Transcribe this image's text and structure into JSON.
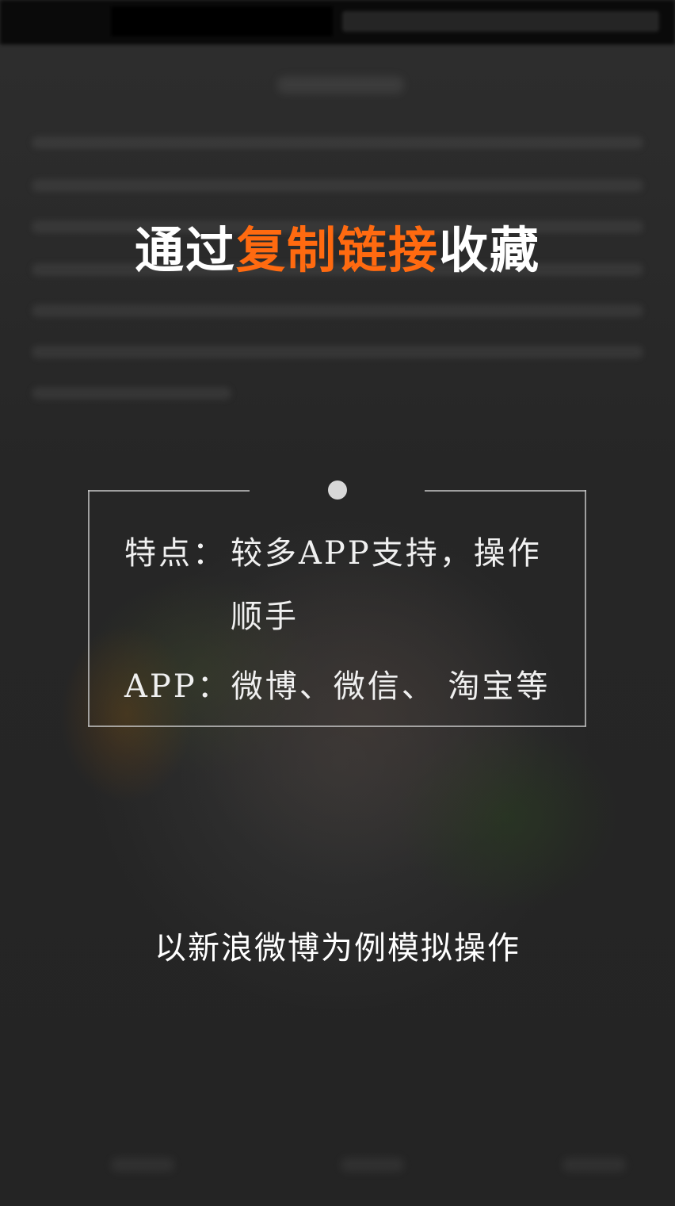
{
  "overlay": {
    "title_prefix": "通过",
    "title_accent": "复制链接",
    "title_suffix": "收藏",
    "accent_color": "#ff6a10",
    "card": {
      "features_label": "特点：",
      "features_text": "较多APP支持，操作",
      "features_text_cont": "顺手",
      "apps_label": "APP：",
      "apps_text": "微博、微信、 淘宝等"
    },
    "caption": "以新浪微博为例模拟操作"
  }
}
